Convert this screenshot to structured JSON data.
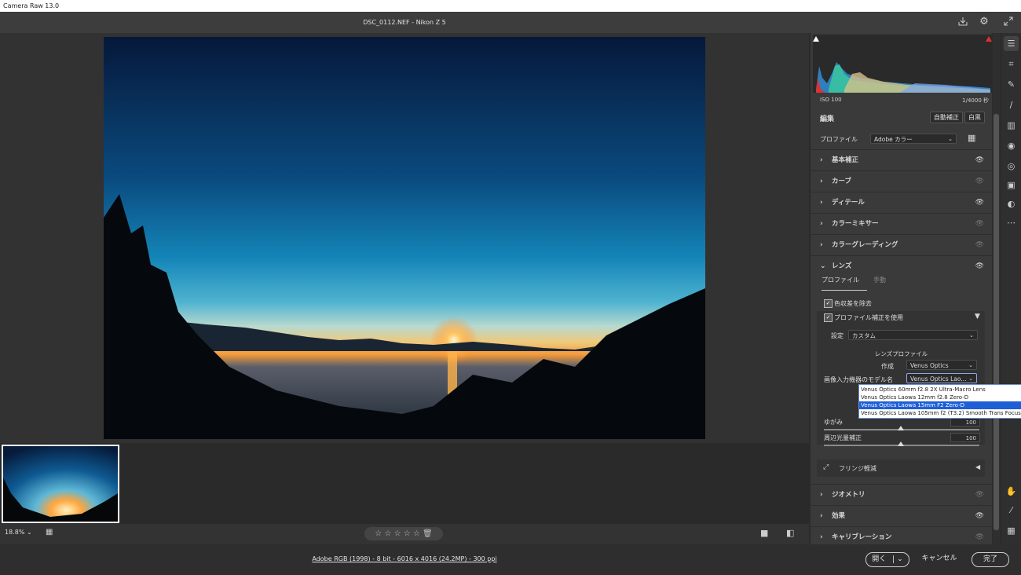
{
  "window": {
    "title": "Camera Raw 13.0"
  },
  "header": {
    "file_title": "DSC_0112.NEF  -  Nikon Z 5"
  },
  "viewer": {
    "zoom_label": "18.8%"
  },
  "footer": {
    "workflow_link": "Adobe RGB (1998) - 8 bit - 6016 x 4016 (24.2MP) - 300 ppi",
    "open_label": "開く",
    "cancel_label": "キャンセル",
    "done_label": "完了"
  },
  "histogram": {
    "iso": "ISO 100",
    "shutter": "1/4000 秒"
  },
  "edit": {
    "title": "編集",
    "auto_label": "自動補正",
    "bw_label": "白黒",
    "profile_label": "プロファイル",
    "profile_value": "Adobe カラー"
  },
  "sections": {
    "basic": "基本補正",
    "curve": "カーブ",
    "detail": "ディテール",
    "color_mixer": "カラーミキサー",
    "color_grading": "カラーグレーディング",
    "lens": "レンズ",
    "geometry": "ジオメトリ",
    "effects": "効果",
    "calibration": "キャリブレーション"
  },
  "lens": {
    "tab_profile": "プロファイル",
    "tab_manual": "手動",
    "remove_ca": "色収差を除去",
    "use_profile": "プロファイル補正を使用",
    "setup_label": "設定",
    "setup_value": "カスタム",
    "lens_profile_heading": "レンズプロファイル",
    "make_label": "作成",
    "make_value": "Venus Optics",
    "model_label": "画像入力機器のモデル名",
    "model_value": "Venus Optics Lao...",
    "distortion_label": "ゆがみ",
    "distortion_value": "100",
    "vignette_label": "周辺光量補正",
    "vignette_value": "100",
    "fringe_label": "フリンジ軽減"
  },
  "dropdown": {
    "options": [
      "Venus Optics 60mm f2.8 2X Ultra-Macro Lens",
      "Venus Optics Laowa 12mm f2.8 Zero-D",
      "Venus Optics Laowa 15mm F2 Zero-D",
      "Venus Optics Laowa 105mm f2 (T3.2) Smooth Trans Focus"
    ],
    "selected_index": 2
  },
  "icons": {
    "save": "save-icon",
    "settings": "gear-icon",
    "fullscreen": "fullscreen-icon",
    "edit": "sliders-icon",
    "crop": "crop-icon",
    "heal": "bandage-icon",
    "brush": "brush-icon",
    "gradient": "gradient-icon",
    "radial": "radial-icon",
    "redeye": "eye-icon",
    "snapshots": "snapshot-icon",
    "presets": "presets-icon",
    "more": "more-icon",
    "hand": "hand-icon",
    "sampler": "eyedropper-icon",
    "grid": "grid-icon"
  },
  "colors": {
    "accent": "#1f5fd6",
    "panel": "#3a3a3a",
    "background": "#2b2b2b"
  }
}
